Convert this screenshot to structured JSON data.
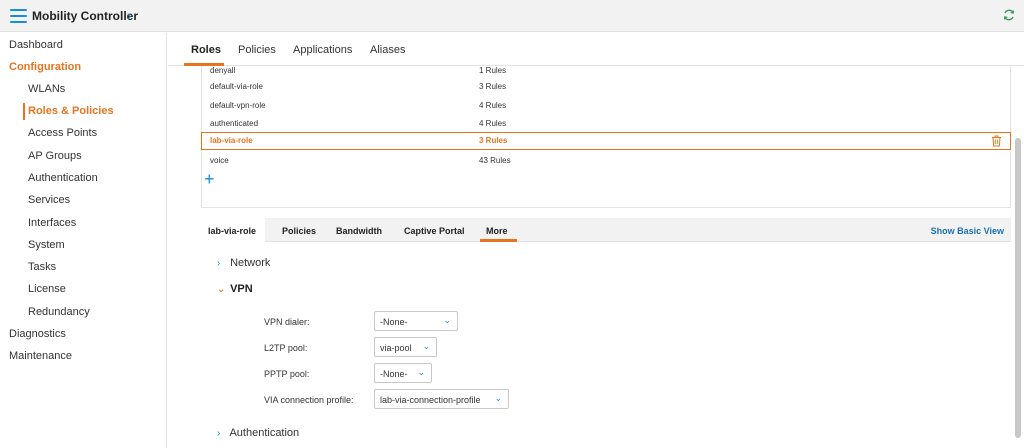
{
  "header": {
    "app_title": "Mobility Controller"
  },
  "sidebar": {
    "items": [
      {
        "label": "Dashboard"
      },
      {
        "label": "Configuration"
      },
      {
        "label": "WLANs"
      },
      {
        "label": "Roles & Policies"
      },
      {
        "label": "Access Points"
      },
      {
        "label": "AP Groups"
      },
      {
        "label": "Authentication"
      },
      {
        "label": "Services"
      },
      {
        "label": "Interfaces"
      },
      {
        "label": "System"
      },
      {
        "label": "Tasks"
      },
      {
        "label": "License"
      },
      {
        "label": "Redundancy"
      },
      {
        "label": "Diagnostics"
      },
      {
        "label": "Maintenance"
      }
    ]
  },
  "tabs": [
    {
      "label": "Roles"
    },
    {
      "label": "Policies"
    },
    {
      "label": "Applications"
    },
    {
      "label": "Aliases"
    }
  ],
  "roles": [
    {
      "name": "denyall",
      "rules": "1 Rules"
    },
    {
      "name": "default-via-role",
      "rules": "3 Rules"
    },
    {
      "name": "default-vpn-role",
      "rules": "4 Rules"
    },
    {
      "name": "authenticated",
      "rules": "4 Rules"
    },
    {
      "name": "lab-via-role",
      "rules": "3 Rules",
      "selected": true
    },
    {
      "name": "voice",
      "rules": "43 Rules"
    }
  ],
  "add_button": "+",
  "detail": {
    "tabs": [
      {
        "label": "lab-via-role"
      },
      {
        "label": "Policies"
      },
      {
        "label": "Bandwidth"
      },
      {
        "label": "Captive Portal"
      },
      {
        "label": "More"
      }
    ],
    "show_basic_view": "Show Basic View"
  },
  "sections": {
    "network": "Network",
    "vpn": "VPN",
    "authentication": "Authentication"
  },
  "vpn_fields": {
    "vpn_dialer": {
      "label": "VPN dialer:",
      "value": "-None-"
    },
    "l2tp_pool": {
      "label": "L2TP pool:",
      "value": "via-pool"
    },
    "pptp_pool": {
      "label": "PPTP pool:",
      "value": "-None-"
    },
    "via_profile": {
      "label": "VIA connection profile:",
      "value": "lab-via-connection-profile"
    }
  },
  "colors": {
    "accent": "#e8741f",
    "link": "#1a8fd6"
  }
}
